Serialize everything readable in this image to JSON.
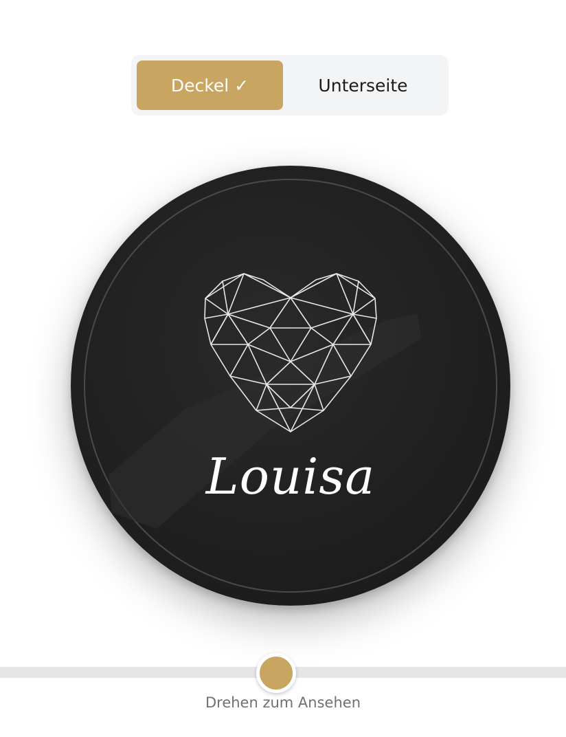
{
  "toggle": {
    "lid_label": "Deckel",
    "lid_check": "✓",
    "bottom_label": "Unterseite",
    "active": "lid",
    "active_color": "#c8a561"
  },
  "coaster": {
    "engraving_text": "Louisa",
    "motif": "geometric-heart-icon",
    "color": "#1f1f1f"
  },
  "rotation_slider": {
    "hint": "Drehen zum Ansehen",
    "value": 0.49,
    "thumb_color": "#c8a561"
  }
}
